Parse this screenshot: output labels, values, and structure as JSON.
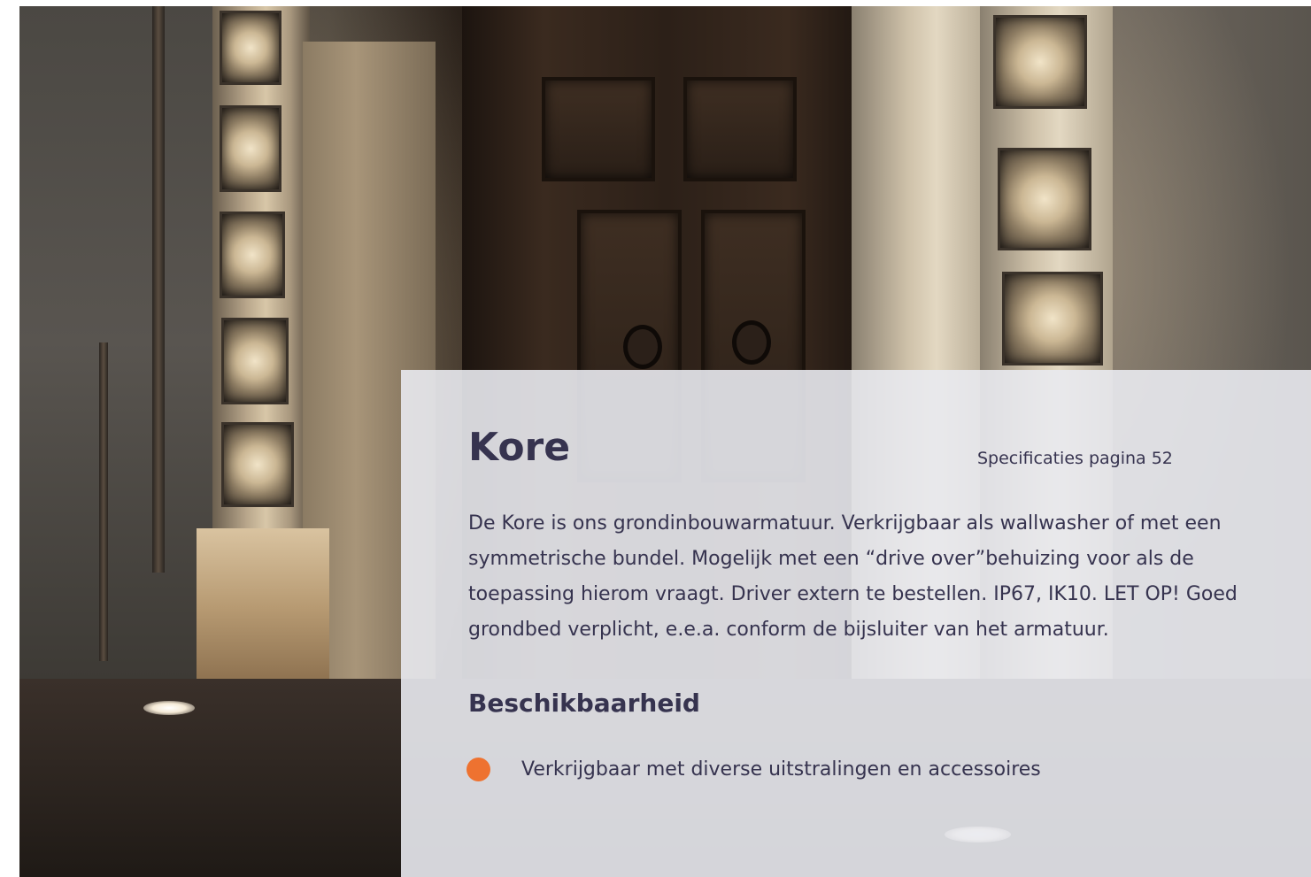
{
  "photo": {
    "subject": "night-lit-building-facade-with-ornamented-pillars"
  },
  "product": {
    "name": "Kore",
    "spec_reference": "Specificaties pagina 52",
    "description": "De Kore is ons grondinbouwarmatuur. Verkrijgbaar als wallwasher of met een symmetrische bundel. Mogelijk met een “drive over”behuizing voor als de toepassing hierom vraagt. Driver extern te bestellen. IP67, IK10. LET OP! Goed grondbed verplicht, e.e.a. conform de bijsluiter van het armatuur."
  },
  "availability": {
    "heading": "Beschikbaarheid",
    "items": [
      {
        "text": "Verkrijgbaar met diverse uitstralingen en accessoires"
      }
    ]
  },
  "colors": {
    "text": "#36334f",
    "accent": "#ee7230",
    "panel": "#e9eaf0"
  }
}
